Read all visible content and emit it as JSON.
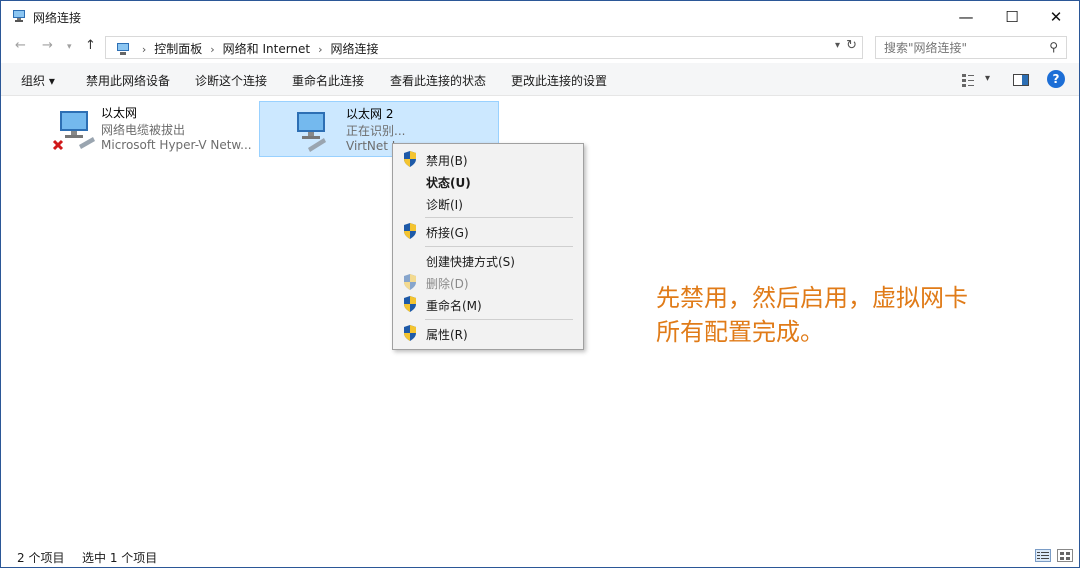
{
  "window": {
    "title": "网络连接"
  },
  "titlebar_buttons": {
    "minimize": "—",
    "maximize": "☐",
    "close": "✕"
  },
  "nav": {
    "back": "←",
    "forward": "→",
    "up": "↑"
  },
  "address": {
    "crumbs": [
      "控制面板",
      "网络和 Internet",
      "网络连接"
    ],
    "separator": "›"
  },
  "search": {
    "placeholder": "搜索\"网络连接\""
  },
  "toolbar": {
    "organize": "组织 ▾",
    "disable": "禁用此网络设备",
    "diagnose": "诊断这个连接",
    "rename": "重命名此连接",
    "view_status": "查看此连接的状态",
    "change_settings": "更改此连接的设置",
    "help": "?"
  },
  "adapters": [
    {
      "name": "以太网",
      "status": "网络电缆被拔出",
      "device": "Microsoft Hyper-V Netw..."
    },
    {
      "name": "以太网 2",
      "status": "正在识别...",
      "device": "VirtNet I"
    }
  ],
  "context_menu": {
    "items": [
      {
        "label": "禁用(B)"
      },
      {
        "label": "状态(U)"
      },
      {
        "label": "诊断(I)"
      },
      {
        "label": "桥接(G)"
      },
      {
        "label": "创建快捷方式(S)"
      },
      {
        "label": "删除(D)"
      },
      {
        "label": "重命名(M)"
      },
      {
        "label": "属性(R)"
      }
    ]
  },
  "annotation": {
    "line1": "先禁用，然后启用，虚拟网卡",
    "line2": "所有配置完成。"
  },
  "statusbar": {
    "count": "2 个项目",
    "selected": "选中 1 个项目"
  },
  "colors": {
    "accent": "#1c6ed6",
    "selection": "#cce8ff",
    "annotation": "#e07b18"
  }
}
